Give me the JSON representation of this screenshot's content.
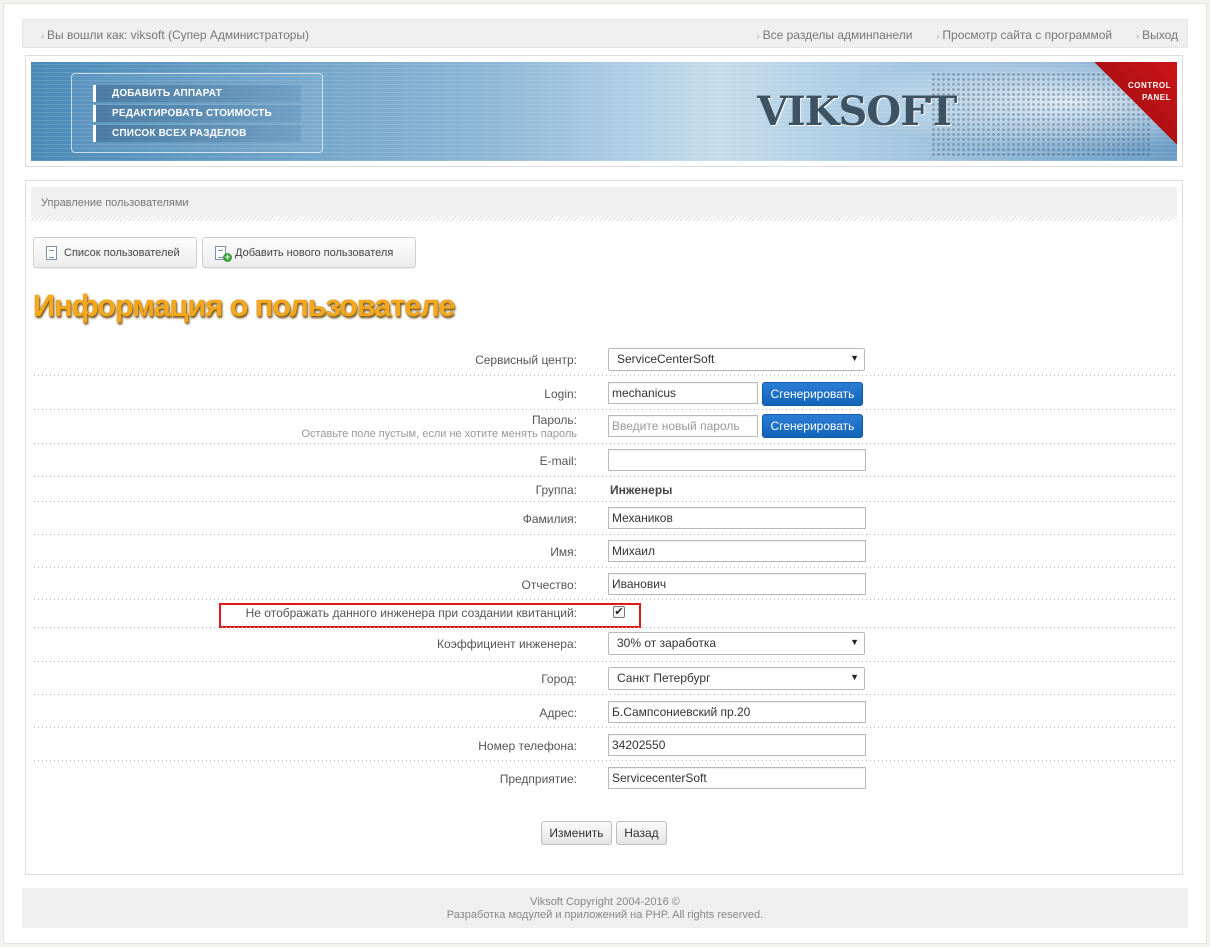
{
  "topbar": {
    "logged_in": "Вы вошли как: viksoft (Супер Администраторы)",
    "links": [
      "Все разделы админпанели",
      "Просмотр сайта с программой",
      "Выход"
    ]
  },
  "banner": {
    "menu": [
      "ДОБАВИТЬ АППАРАТ",
      "РЕДАКТИРОВАТЬ СТОИМОСТЬ",
      "СПИСОК ВСЕХ РАЗДЕЛОВ"
    ],
    "logo": "VIKSOFT",
    "corner_line1": "CONTROL",
    "corner_line2": "PANEL"
  },
  "section": {
    "heading": "Управление пользователями",
    "tabs": [
      "Список пользователей",
      "Добавить нового пользователя"
    ],
    "title": "Информация о пользователе"
  },
  "form": {
    "service_center": {
      "label": "Сервисный центр:",
      "value": "ServiceCenterSoft"
    },
    "login": {
      "label": "Login:",
      "value": "mechanicus",
      "button": "Сгенерировать"
    },
    "password": {
      "label": "Пароль:",
      "hint": "Оставьте поле пустым, если не хотите менять пароль",
      "placeholder": "Введите новый пароль",
      "button": "Сгенерировать"
    },
    "email": {
      "label": "E-mail:",
      "value": ""
    },
    "group": {
      "label": "Группа:",
      "value": "Инженеры"
    },
    "surname": {
      "label": "Фамилия:",
      "value": "Механиков"
    },
    "name": {
      "label": "Имя:",
      "value": "Михаил"
    },
    "patronymic": {
      "label": "Отчество:",
      "value": "Иванович"
    },
    "hide_engineer": {
      "label": "Не отображать данного инженера при создании квитанций:",
      "checked": true,
      "mark": "✔"
    },
    "coefficient": {
      "label": "Коэффициент инженера:",
      "value": "30% от заработка"
    },
    "city": {
      "label": "Город:",
      "value": "Санкт Петербург"
    },
    "address": {
      "label": "Адрес:",
      "value": "Б.Сампсониевский пр.20"
    },
    "phone": {
      "label": "Номер телефона:",
      "value": "34202550"
    },
    "company": {
      "label": "Предприятие:",
      "value": "ServicecenterSoft"
    }
  },
  "actions": {
    "save": "Изменить",
    "back": "Назад"
  },
  "footer": {
    "line1": "Viksoft   Copyright 2004-2016 ©",
    "line2": "Разработка модулей и приложений на PHP. All rights reserved."
  },
  "colors": {
    "title": "#f6a81c",
    "button_blue": "#1a6fc6",
    "highlight": "#e01818"
  }
}
